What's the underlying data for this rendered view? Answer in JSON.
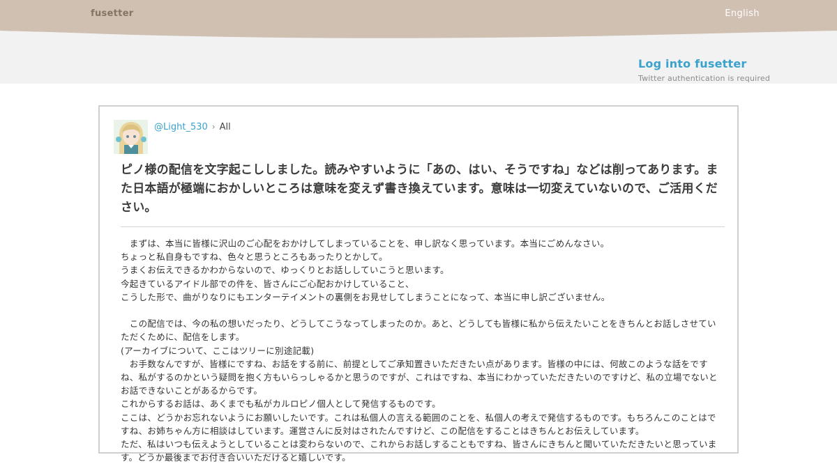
{
  "header": {
    "brand": "fusetter",
    "language": "English",
    "colors": {
      "band": "#d0c0b2",
      "accent": "#3aa2cc"
    }
  },
  "login": {
    "label": "Log into fusetter",
    "note": "Twitter authentication is required"
  },
  "tweet": {
    "username": "@Light_530",
    "separator": "›",
    "scope": "All",
    "title": "ピノ様の配信を文字起こししました。読みやすいように「あの、はい、そうですね」などは削ってあります。また日本語が極端におかしいところは意味を変えず書き換えています。意味は一切変えていないので、ご活用ください。",
    "lines": [
      "　まずは、本当に皆様に沢山のご心配をおかけしてしまっていることを、申し訳なく思っています。本当にごめんなさい。",
      "ちょっと私自身もですね、色々と思うところもあったりとかして。",
      "うまくお伝えできるかわからないので、ゆっくりとお話ししていこうと思います。",
      "今起きているアイドル部での件を、皆さんにご心配おかけしていること、",
      "こうした形で、曲がりなりにもエンターテイメントの裏側をお見せしてしまうことになって、本当に申し訳ございません。",
      "",
      "　この配信では、今の私の想いだったり、どうしてこうなってしまったのか。あと、どうしても皆様に私から伝えたいことをきちんとお話しさせていただくために、配信をします。",
      "(アーカイブについて、ここはツリーに別途記載)",
      "　お手数なんですが、皆様にですね、お話をする前に、前提としてご承知置きいただきたい点があります。皆様の中には、何故このような話をですね、私がするのかという疑問を抱く方もいらっしゃるかと思うのですが、これはですね、本当にわかっていただきたいのですけど、私の立場でないとお話できないことがあるからです。",
      "これからするお話は、あくまでも私がカルロピノ個人として発信するものです。",
      "ここは、どうかお忘れないようにお願いしたいです。これは私個人の言える範囲のことを、私個人の考えで発信するものです。もちろんこのことはですね、お姉ちゃん方に相談はしています。運営さんに反対はされたんですけど、この配信をすることはきちんとお伝えしています。",
      "ただ、私はいつも伝えようとしていることは変わらないので、これからお話しすることもですね、皆さんにきちんと聞いていただきたいと思っています。どうか最後までお付き合いいただけると嬉しいです。"
    ]
  }
}
